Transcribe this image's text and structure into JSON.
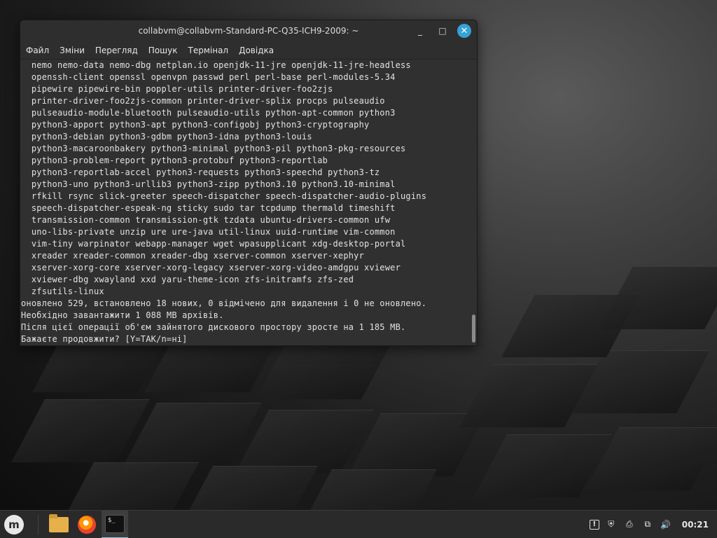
{
  "window": {
    "title": "collabvm@collabvm-Standard-PC-Q35-ICH9-2009: ~",
    "minimize_label": "_",
    "maximize_label": "□",
    "close_label": "✕"
  },
  "menu": {
    "items": [
      {
        "label": "Файл"
      },
      {
        "label": "Зміни"
      },
      {
        "label": "Перегляд"
      },
      {
        "label": "Пошук"
      },
      {
        "label": "Термінал"
      },
      {
        "label": "Довідка"
      }
    ]
  },
  "terminal": {
    "lines": [
      "  nemo nemo-data nemo-dbg netplan.io openjdk-11-jre openjdk-11-jre-headless",
      "  openssh-client openssl openvpn passwd perl perl-base perl-modules-5.34",
      "  pipewire pipewire-bin poppler-utils printer-driver-foo2zjs",
      "  printer-driver-foo2zjs-common printer-driver-splix procps pulseaudio",
      "  pulseaudio-module-bluetooth pulseaudio-utils python-apt-common python3",
      "  python3-apport python3-apt python3-configobj python3-cryptography",
      "  python3-debian python3-gdbm python3-idna python3-louis",
      "  python3-macaroonbakery python3-minimal python3-pil python3-pkg-resources",
      "  python3-problem-report python3-protobuf python3-reportlab",
      "  python3-reportlab-accel python3-requests python3-speechd python3-tz",
      "  python3-uno python3-urllib3 python3-zipp python3.10 python3.10-minimal",
      "  rfkill rsync slick-greeter speech-dispatcher speech-dispatcher-audio-plugins",
      "  speech-dispatcher-espeak-ng sticky sudo tar tcpdump thermald timeshift",
      "  transmission-common transmission-gtk tzdata ubuntu-drivers-common ufw",
      "  uno-libs-private unzip ure ure-java util-linux uuid-runtime vim-common",
      "  vim-tiny warpinator webapp-manager wget wpasupplicant xdg-desktop-portal",
      "  xreader xreader-common xreader-dbg xserver-common xserver-xephyr",
      "  xserver-xorg-core xserver-xorg-legacy xserver-xorg-video-amdgpu xviewer",
      "  xviewer-dbg xwayland xxd yaru-theme-icon zfs-initramfs zfs-zed",
      "  zfsutils-linux",
      "оновлено 529, встановлено 18 нових, 0 відмічено для видалення і 0 не оновлено.",
      "Необхідно завантажити 1 088 MB архівів.",
      "Після цієї операції об'єм зайнятого дискового простору зросте на 1 185 MB.",
      "Бажаєте продовжити? [Y=ТАК/n=ні]"
    ]
  },
  "taskbar": {
    "menu_logo": "m",
    "apps": [
      {
        "name": "file-manager",
        "icon": "folder-icon"
      },
      {
        "name": "firefox",
        "icon": "firefox-icon"
      },
      {
        "name": "terminal",
        "icon": "terminal-icon",
        "text": "$_"
      }
    ],
    "tray": {
      "update_icon": "!",
      "shield_icon": "⛨",
      "clipboard_icon": "⎙",
      "network_icon": "⧉",
      "volume_icon": "🔊",
      "clock": "00:21"
    }
  }
}
